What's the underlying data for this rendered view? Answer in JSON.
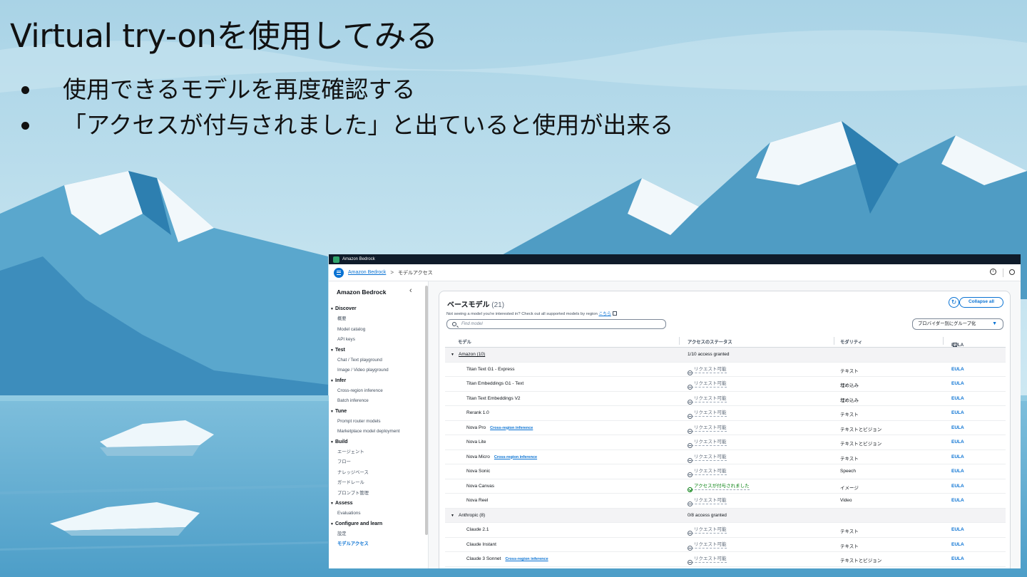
{
  "slide": {
    "title": "Virtual try-onを使用してみる",
    "bullets": [
      "使用できるモデルを再度確認する",
      "「アクセスが付与されました」と出ていると使用が出来る"
    ]
  },
  "console": {
    "app_name": "Amazon Bedrock",
    "breadcrumb": {
      "root": "Amazon Bedrock",
      "separator": ">",
      "current": "モデルアクセス"
    },
    "sidebar": {
      "title": "Amazon Bedrock",
      "close": "‹",
      "sections": [
        {
          "label": "Discover",
          "items": [
            "概要",
            "Model catalog",
            "API keys"
          ]
        },
        {
          "label": "Test",
          "items": [
            "Chat / Text playground",
            "Image / Video playground"
          ]
        },
        {
          "label": "Infer",
          "items": [
            "Cross-region inference",
            "Batch inference"
          ]
        },
        {
          "label": "Tune",
          "items": [
            "Prompt router models",
            "Marketplace model deployment"
          ]
        },
        {
          "label": "Build",
          "items": [
            "エージェント",
            "フロー",
            "ナレッジベース",
            "ガードレール",
            "プロンプト管理"
          ]
        },
        {
          "label": "Assess",
          "items": [
            "Evaluations"
          ]
        },
        {
          "label": "Configure and learn",
          "items": [
            "設定",
            "モデルアクセス"
          ]
        }
      ],
      "active_item": "モデルアクセス"
    },
    "panel": {
      "title": "ベースモデル",
      "count": "(21)",
      "collapse_label": "Collapse all",
      "description": "Not seeing a model you're interested in? Check out all supported models by region",
      "description_link": "こちら",
      "search_placeholder": "Find model",
      "group_select": "プロバイダー別にグループ化",
      "columns": {
        "model": "モデル",
        "status": "アクセスのステータス",
        "modality": "モダリティ",
        "eula": "EULA"
      }
    },
    "groups": [
      {
        "name": "Amazon (10)",
        "status": "1/10 access granted",
        "rows": [
          {
            "model": "Titan Text G1 - Express",
            "badge": "",
            "status": "リクエスト可能",
            "granted": false,
            "modality": "テキスト",
            "eula": "EULA"
          },
          {
            "model": "Titan Embeddings G1 - Text",
            "badge": "",
            "status": "リクエスト可能",
            "granted": false,
            "modality": "埋め込み",
            "eula": "EULA"
          },
          {
            "model": "Titan Text Embeddings V2",
            "badge": "",
            "status": "リクエスト可能",
            "granted": false,
            "modality": "埋め込み",
            "eula": "EULA"
          },
          {
            "model": "Rerank 1.0",
            "badge": "",
            "status": "リクエスト可能",
            "granted": false,
            "modality": "テキスト",
            "eula": "EULA"
          },
          {
            "model": "Nova Pro",
            "badge": "Cross-region inference",
            "status": "リクエスト可能",
            "granted": false,
            "modality": "テキストとビジョン",
            "eula": "EULA"
          },
          {
            "model": "Nova Lite",
            "badge": "",
            "status": "リクエスト可能",
            "granted": false,
            "modality": "テキストとビジョン",
            "eula": "EULA"
          },
          {
            "model": "Nova Micro",
            "badge": "Cross-region inference",
            "status": "リクエスト可能",
            "granted": false,
            "modality": "テキスト",
            "eula": "EULA"
          },
          {
            "model": "Nova Sonic",
            "badge": "",
            "status": "リクエスト可能",
            "granted": false,
            "modality": "Speech",
            "eula": "EULA"
          },
          {
            "model": "Nova Canvas",
            "badge": "",
            "status": "アクセスが付与されました",
            "granted": true,
            "modality": "イメージ",
            "eula": "EULA"
          },
          {
            "model": "Nova Reel",
            "badge": "",
            "status": "リクエスト可能",
            "granted": false,
            "modality": "Video",
            "eula": "EULA"
          }
        ]
      },
      {
        "name": "Anthropic (8)",
        "status": "0/8 access granted",
        "rows": [
          {
            "model": "Claude 2.1",
            "badge": "",
            "status": "リクエスト可能",
            "granted": false,
            "modality": "テキスト",
            "eula": "EULA"
          },
          {
            "model": "Claude Instant",
            "badge": "",
            "status": "リクエスト可能",
            "granted": false,
            "modality": "テキスト",
            "eula": "EULA"
          },
          {
            "model": "Claude 3 Sonnet",
            "badge": "Cross-region inference",
            "status": "リクエスト可能",
            "granted": false,
            "modality": "テキストとビジョン",
            "eula": "EULA"
          }
        ]
      }
    ],
    "colors": {
      "accent": "#0972d3",
      "granted": "#037f0c",
      "topbar": "#0f1b2a"
    }
  }
}
